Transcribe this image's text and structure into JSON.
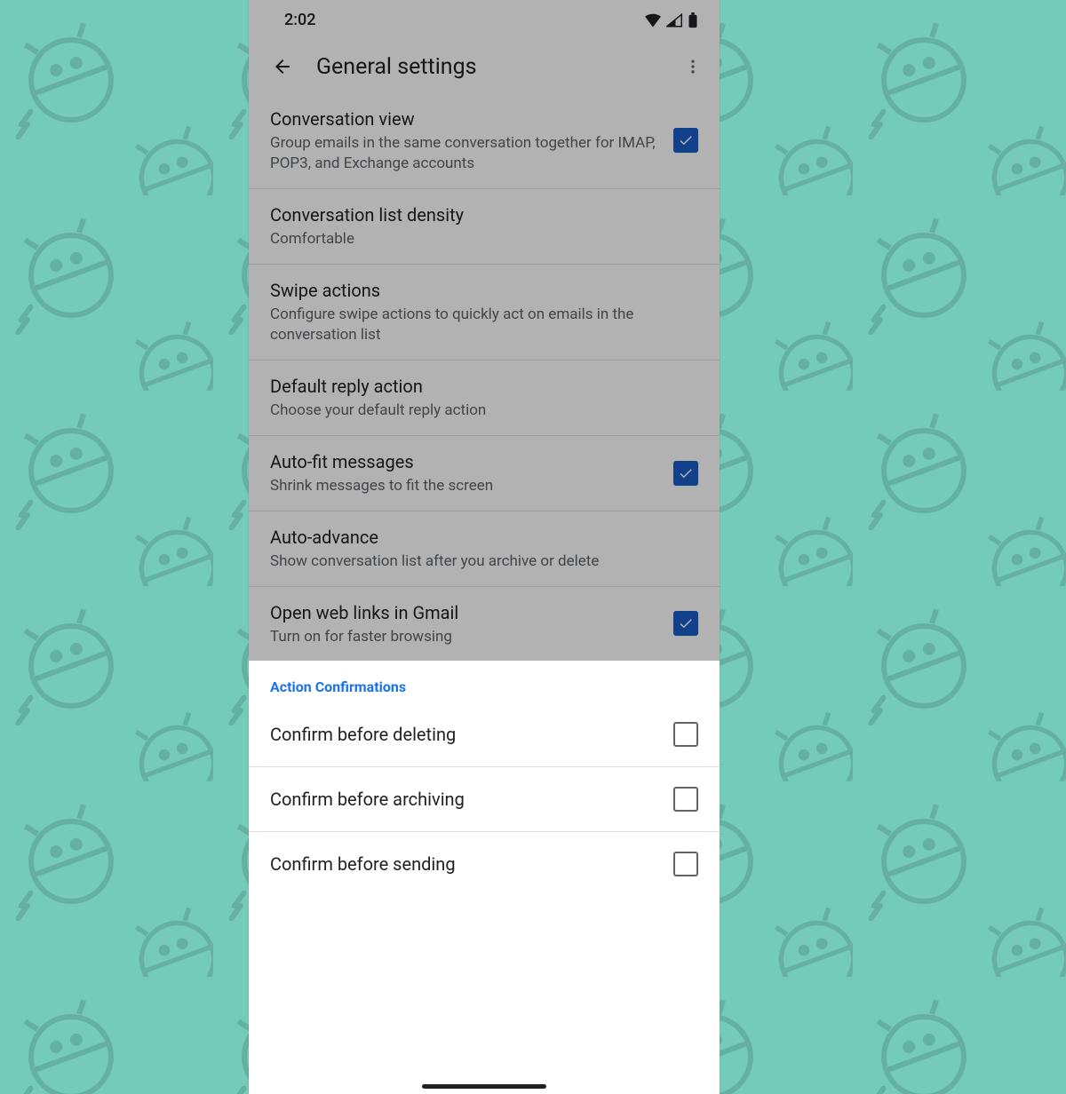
{
  "status": {
    "time": "2:02"
  },
  "header": {
    "title": "General settings"
  },
  "rows": {
    "conversation_view": {
      "title": "Conversation view",
      "sub": "Group emails in the same conversation together for IMAP, POP3, and Exchange accounts"
    },
    "density": {
      "title": "Conversation list density",
      "sub": "Comfortable"
    },
    "swipe": {
      "title": "Swipe actions",
      "sub": "Configure swipe actions to quickly act on emails in the conversation list"
    },
    "reply": {
      "title": "Default reply action",
      "sub": "Choose your default reply action"
    },
    "autofit": {
      "title": "Auto-fit messages",
      "sub": "Shrink messages to fit the screen"
    },
    "autoadvance": {
      "title": "Auto-advance",
      "sub": "Show conversation list after you archive or delete"
    },
    "openlinks": {
      "title": "Open web links in Gmail",
      "sub": "Turn on for faster browsing"
    }
  },
  "section_header": "Action Confirmations",
  "confirmations": {
    "delete": "Confirm before deleting",
    "archive": "Confirm before archiving",
    "send": "Confirm before sending"
  }
}
